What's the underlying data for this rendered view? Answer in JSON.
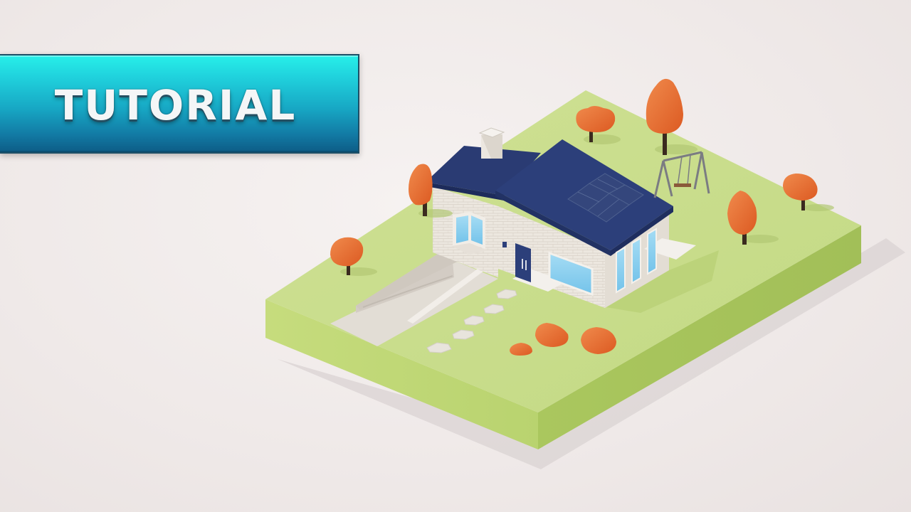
{
  "banner": {
    "label": "TUTORIAL"
  },
  "colors": {
    "background": "#f1eceb",
    "banner_top": "#27f0e9",
    "banner_bottom": "#0d5c86",
    "grass_top": "#c9dd8c",
    "grass_side": "#b3cd6b",
    "roof": "#2c3f78",
    "wall": "#ece7e0",
    "window": "#8fd2ef",
    "tree": "#e8642c",
    "trunk": "#3a2a1f"
  }
}
